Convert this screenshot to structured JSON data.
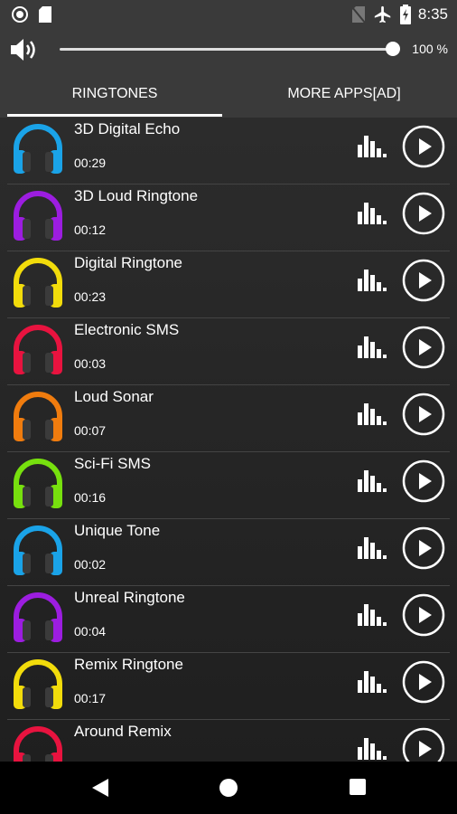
{
  "status": {
    "time": "8:35"
  },
  "volume": {
    "percent_label": "100 %",
    "level": 1.0
  },
  "tabs": [
    {
      "label": "RINGTONES",
      "active": true
    },
    {
      "label": "MORE APPS[AD]",
      "active": false
    }
  ],
  "ringtones": [
    {
      "title": "3D Digital Echo",
      "duration": "00:29",
      "color": "#1aa3e8"
    },
    {
      "title": "3D Loud Ringtone",
      "duration": "00:12",
      "color": "#9c1de0"
    },
    {
      "title": "Digital Ringtone",
      "duration": "00:23",
      "color": "#f2dc0b"
    },
    {
      "title": "Electronic SMS",
      "duration": "00:03",
      "color": "#e8133f"
    },
    {
      "title": "Loud Sonar",
      "duration": "00:07",
      "color": "#f07c0e"
    },
    {
      "title": "Sci-Fi SMS",
      "duration": "00:16",
      "color": "#77e00e"
    },
    {
      "title": "Unique Tone",
      "duration": "00:02",
      "color": "#1aa3e8"
    },
    {
      "title": "Unreal Ringtone",
      "duration": "00:04",
      "color": "#9c1de0"
    },
    {
      "title": "Remix Ringtone",
      "duration": "00:17",
      "color": "#f2dc0b"
    },
    {
      "title": "Around Remix",
      "duration": "",
      "color": "#e8133f"
    }
  ],
  "icons": {
    "status_left": [
      "record-icon",
      "sd-card-icon"
    ],
    "status_right": [
      "no-sim-icon",
      "airplane-icon",
      "battery-charging-icon"
    ],
    "volume": "speaker-icon",
    "row_visualizer": "equalizer-icon",
    "row_play": "play-circle-icon",
    "nav": [
      "back-icon",
      "home-icon",
      "recent-apps-icon"
    ]
  }
}
